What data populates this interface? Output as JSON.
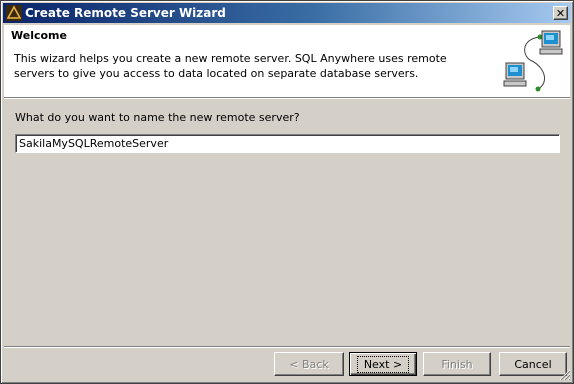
{
  "window": {
    "title": "Create Remote Server Wizard",
    "close_label": "✕"
  },
  "header": {
    "title": "Welcome",
    "description": "This wizard helps you create a new remote server. SQL Anywhere uses remote servers to give you access to data located on separate database servers."
  },
  "form": {
    "question": "What do you want to name the new remote server?",
    "server_name_value": "SakilaMySQLRemoteServer"
  },
  "buttons": {
    "back": "< Back",
    "next": "Next >",
    "finish": "Finish",
    "cancel": "Cancel"
  },
  "colors": {
    "titlebar_start": "#0a246a",
    "titlebar_end": "#a6caf0",
    "face": "#d4d0c8"
  },
  "icons": {
    "app": "sql-anywhere-icon",
    "header": "networked-computers-icon",
    "close": "close-icon"
  }
}
